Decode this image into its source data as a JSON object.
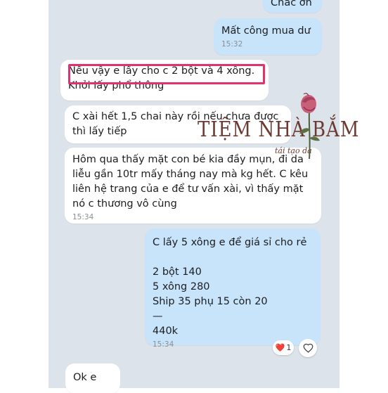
{
  "messages": [
    {
      "text": "Chắc ơn",
      "time": ""
    },
    {
      "text": "Mất công mua dư",
      "time": "15:32"
    },
    {
      "text": "Nếu vậy e lấy cho c 2 bột và 4 xông. Khỏi lấy phổ thông",
      "time": ""
    },
    {
      "text": "C xài hết 1,5 chai này rồi nếu chưa được thì lấy tiếp",
      "time": ""
    },
    {
      "text": "Hôm qua thấy mặt con bé kia đầy mụn, đi da liễu gần 10tr mấy tháng nay mà kg hết. C kêu liên hệ trang của e để tư vấn xài, vì thấy mặt nó c thương vô cùng",
      "time": "15:34"
    },
    {
      "text": "C lấy 5 xông e để giá sỉ cho rẻ\n\n2 bột 140\n5 xông 280\nShip 35 phụ 15 còn 20\n—\n440k",
      "time": "15:34"
    },
    {
      "text": "Ok e",
      "time": ""
    }
  ],
  "reaction": {
    "emoji": "❤️",
    "count": "1"
  },
  "watermark": {
    "title": "TIỆM NHÀ BẮM",
    "subtitle": "tái tạo da"
  },
  "colors": {
    "chat_bg": "#dde3ea",
    "incoming": "#ffffff",
    "outgoing": "#c8e4fb",
    "highlight": "#e0336b",
    "watermark": "#6b3a32"
  }
}
